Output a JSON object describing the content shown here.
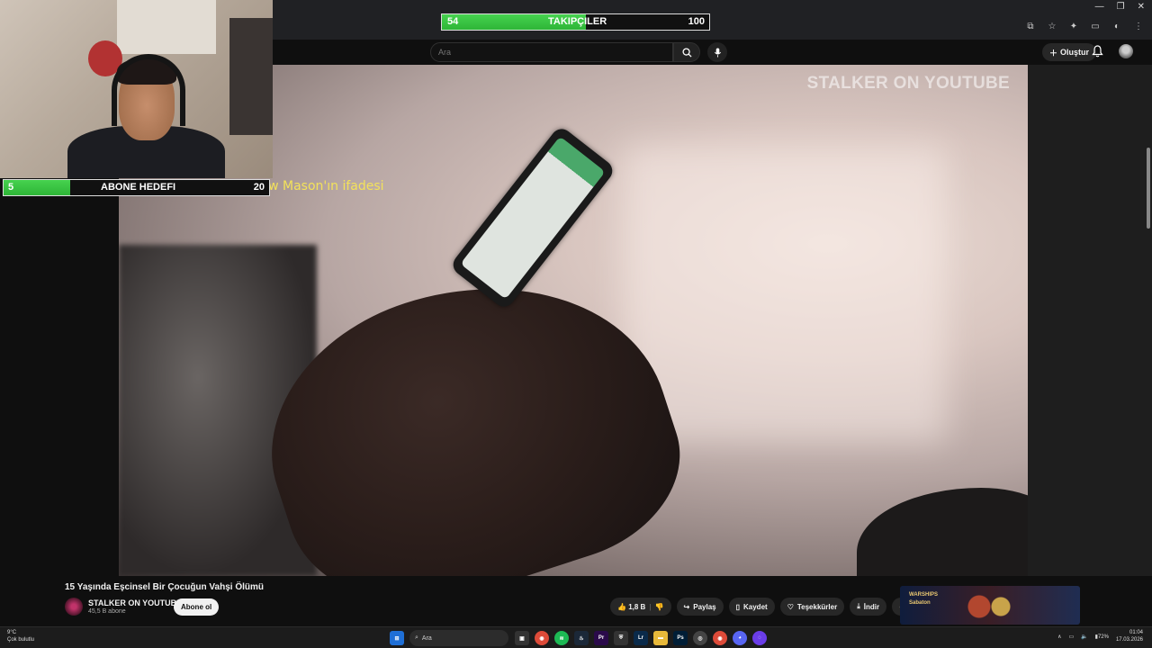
{
  "follower_goal": {
    "label": "TAKIPÇILER",
    "current": "54",
    "target": "100",
    "progress": 0.54
  },
  "subscriber_goal": {
    "label": "ABONE HEDEFI",
    "current": "5",
    "target": "20",
    "progress": 0.25
  },
  "caption": "Matthew Mason'ın ifadesi",
  "watermark": "STALKER ON YOUTUBE",
  "header": {
    "search_placeholder": "Ara",
    "create_label": "Oluştur"
  },
  "video": {
    "title": "15 Yaşında Eşcinsel Bir Çocuğun Vahşi Ölümü"
  },
  "channel": {
    "name": "STALKER ON YOUTUBE",
    "subscribers": "45,5 B abone",
    "subscribe_label": "Abone ol"
  },
  "actions": {
    "likes": "1,8 B",
    "share": "Paylaş",
    "save": "Kaydet",
    "thanks": "Teşekkürler",
    "download": "İndir"
  },
  "taskbar": {
    "temperature": "9°C",
    "weather": "Çok bulutlu",
    "search": "Ara",
    "battery": "72%",
    "time": "01:04",
    "date": "17.03.2026"
  },
  "colors": {
    "goal_fill": "#3ac244",
    "caption": "#f3e25a",
    "background": "#0f0f0f"
  }
}
